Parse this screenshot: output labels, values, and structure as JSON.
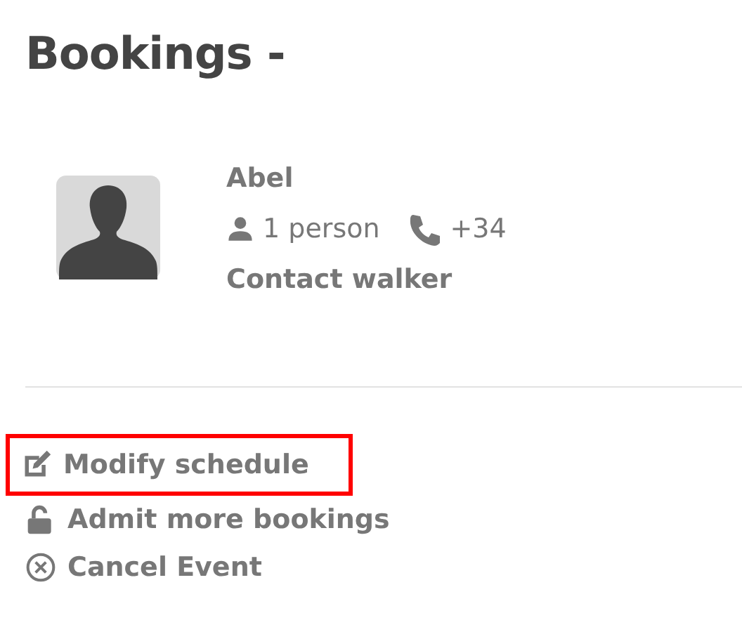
{
  "title": "Bookings -",
  "booking": {
    "name": "Abel",
    "people": "1 person",
    "phone": "+34",
    "contact": "Contact walker"
  },
  "actions": [
    {
      "kind": "edit",
      "label": "Modify schedule",
      "highlighted": true
    },
    {
      "kind": "unlock",
      "label": "Admit more bookings",
      "highlighted": false
    },
    {
      "kind": "cancel",
      "label": "Cancel Event",
      "highlighted": false
    }
  ]
}
